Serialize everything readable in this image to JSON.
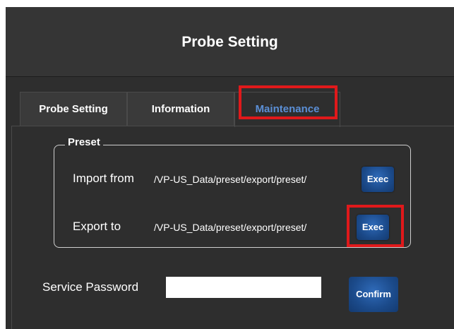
{
  "window": {
    "title": "Probe Setting"
  },
  "tabs": [
    {
      "label": "Probe Setting",
      "active": false
    },
    {
      "label": "Information",
      "active": false
    },
    {
      "label": "Maintenance",
      "active": true
    }
  ],
  "preset": {
    "legend": "Preset",
    "import": {
      "label": "Import from",
      "path": "/VP-US_Data/preset/export/preset/",
      "button": "Exec"
    },
    "export": {
      "label": "Export to",
      "path": "/VP-US_Data/preset/export/preset/",
      "button": "Exec"
    }
  },
  "service": {
    "label": "Service Password",
    "password_value": "",
    "confirm_label": "Confirm"
  },
  "colors": {
    "highlight": "#e0191b",
    "active_tab_text": "#5b8fd6",
    "button_blue": "#1b4a8a",
    "background": "#2e2e2e"
  }
}
